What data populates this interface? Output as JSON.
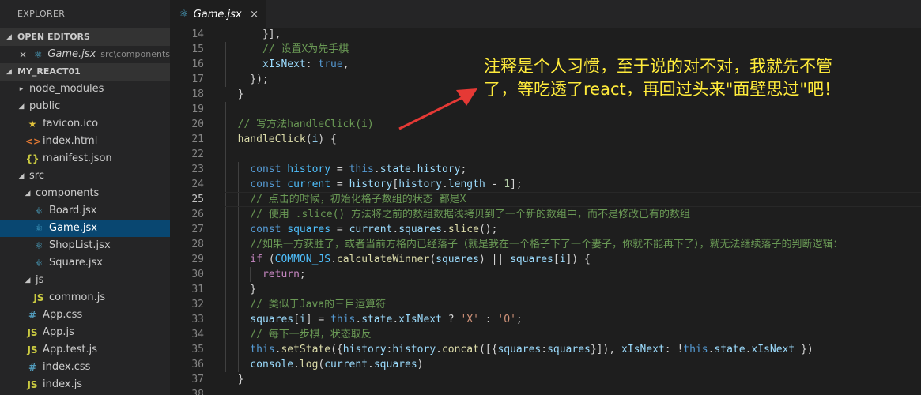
{
  "sidebar": {
    "title": "EXPLORER",
    "open_editors": {
      "header": "OPEN EDITORS",
      "items": [
        {
          "name": "Game.jsx",
          "path": "src\\components",
          "icon": "react-icon"
        }
      ]
    },
    "project": {
      "header": "MY_REACT01",
      "tree": [
        {
          "label": "node_modules",
          "type": "folder",
          "expanded": false,
          "depth": 0
        },
        {
          "label": "public",
          "type": "folder",
          "expanded": true,
          "depth": 0
        },
        {
          "label": "favicon.ico",
          "type": "file",
          "icon": "star-icon",
          "depth": 1
        },
        {
          "label": "index.html",
          "type": "file",
          "icon": "html-icon",
          "depth": 1
        },
        {
          "label": "manifest.json",
          "type": "file",
          "icon": "json-icon",
          "depth": 1
        },
        {
          "label": "src",
          "type": "folder",
          "expanded": true,
          "depth": 0
        },
        {
          "label": "components",
          "type": "folder",
          "expanded": true,
          "depth": 1
        },
        {
          "label": "Board.jsx",
          "type": "file",
          "icon": "react-icon",
          "depth": 2
        },
        {
          "label": "Game.jsx",
          "type": "file",
          "icon": "react-icon",
          "depth": 2,
          "active": true
        },
        {
          "label": "ShopList.jsx",
          "type": "file",
          "icon": "react-icon",
          "depth": 2
        },
        {
          "label": "Square.jsx",
          "type": "file",
          "icon": "react-icon",
          "depth": 2
        },
        {
          "label": "js",
          "type": "folder",
          "expanded": true,
          "depth": 1
        },
        {
          "label": "common.js",
          "type": "file",
          "icon": "js-icon",
          "depth": 2
        },
        {
          "label": "App.css",
          "type": "file",
          "icon": "css-icon",
          "depth": 1
        },
        {
          "label": "App.js",
          "type": "file",
          "icon": "js-icon",
          "depth": 1
        },
        {
          "label": "App.test.js",
          "type": "file",
          "icon": "js-icon",
          "depth": 1
        },
        {
          "label": "index.css",
          "type": "file",
          "icon": "css-icon",
          "depth": 1
        },
        {
          "label": "index.js",
          "type": "file",
          "icon": "js-icon",
          "depth": 1
        }
      ]
    }
  },
  "tab": {
    "label": "Game.jsx",
    "icon": "react-icon",
    "close": "×"
  },
  "editor": {
    "current_line": 25,
    "lines": [
      {
        "n": "14",
        "tokens": [
          [
            "op",
            "      }],"
          ]
        ]
      },
      {
        "n": "15",
        "tokens": [
          [
            "cm",
            "      // 设置X为先手棋"
          ]
        ]
      },
      {
        "n": "16",
        "tokens": [
          [
            "var",
            "      xIsNext"
          ],
          [
            "op",
            ": "
          ],
          [
            "kw",
            "true"
          ],
          [
            "op",
            ","
          ]
        ]
      },
      {
        "n": "17",
        "tokens": [
          [
            "op",
            "    });"
          ]
        ]
      },
      {
        "n": "18",
        "tokens": [
          [
            "op",
            "  }"
          ]
        ]
      },
      {
        "n": "19",
        "tokens": []
      },
      {
        "n": "20",
        "tokens": [
          [
            "cm",
            "  // 写方法handleClick(i)"
          ]
        ]
      },
      {
        "n": "21",
        "tokens": [
          [
            "fn",
            "  handleClick"
          ],
          [
            "op",
            "("
          ],
          [
            "var",
            "i"
          ],
          [
            "op",
            ") {"
          ]
        ]
      },
      {
        "n": "22",
        "tokens": []
      },
      {
        "n": "23",
        "tokens": [
          [
            "kw",
            "    const "
          ],
          [
            "const",
            "history"
          ],
          [
            "op",
            " = "
          ],
          [
            "kw",
            "this"
          ],
          [
            "op",
            "."
          ],
          [
            "var",
            "state"
          ],
          [
            "op",
            "."
          ],
          [
            "var",
            "history"
          ],
          [
            "op",
            ";"
          ]
        ]
      },
      {
        "n": "24",
        "tokens": [
          [
            "kw",
            "    const "
          ],
          [
            "const",
            "current"
          ],
          [
            "op",
            " = "
          ],
          [
            "var",
            "history"
          ],
          [
            "op",
            "["
          ],
          [
            "var",
            "history"
          ],
          [
            "op",
            "."
          ],
          [
            "var",
            "length"
          ],
          [
            "op",
            " - "
          ],
          [
            "num",
            "1"
          ],
          [
            "op",
            "];"
          ]
        ]
      },
      {
        "n": "25",
        "tokens": [
          [
            "cm",
            "    // 点击的时候，初始化格子数组的状态 都是X"
          ]
        ]
      },
      {
        "n": "26",
        "tokens": [
          [
            "cm",
            "    // 使用 .slice() 方法将之前的数组数据浅拷贝到了一个新的数组中，而不是修改已有的数组"
          ]
        ]
      },
      {
        "n": "27",
        "tokens": [
          [
            "kw",
            "    const "
          ],
          [
            "const",
            "squares"
          ],
          [
            "op",
            " = "
          ],
          [
            "var",
            "current"
          ],
          [
            "op",
            "."
          ],
          [
            "var",
            "squares"
          ],
          [
            "op",
            "."
          ],
          [
            "fn",
            "slice"
          ],
          [
            "op",
            "();"
          ]
        ]
      },
      {
        "n": "28",
        "tokens": [
          [
            "cm",
            "    //如果一方获胜了，或者当前方格内已经落子（就是我在一个格子下了一个妻子，你就不能再下了），就无法继续落子的判断逻辑："
          ]
        ]
      },
      {
        "n": "29",
        "tokens": [
          [
            "ctl",
            "    if "
          ],
          [
            "op",
            "("
          ],
          [
            "const",
            "COMMON_JS"
          ],
          [
            "op",
            "."
          ],
          [
            "fn",
            "calculateWinner"
          ],
          [
            "op",
            "("
          ],
          [
            "var",
            "squares"
          ],
          [
            "op",
            ") || "
          ],
          [
            "var",
            "squares"
          ],
          [
            "op",
            "["
          ],
          [
            "var",
            "i"
          ],
          [
            "op",
            "]) {"
          ]
        ]
      },
      {
        "n": "30",
        "tokens": [
          [
            "ctl",
            "      return"
          ],
          [
            "op",
            ";"
          ]
        ]
      },
      {
        "n": "31",
        "tokens": [
          [
            "op",
            "    }"
          ]
        ]
      },
      {
        "n": "32",
        "tokens": [
          [
            "cm",
            "    // 类似于Java的三目运算符"
          ]
        ]
      },
      {
        "n": "33",
        "tokens": [
          [
            "var",
            "    squares"
          ],
          [
            "op",
            "["
          ],
          [
            "var",
            "i"
          ],
          [
            "op",
            "] = "
          ],
          [
            "kw",
            "this"
          ],
          [
            "op",
            "."
          ],
          [
            "var",
            "state"
          ],
          [
            "op",
            "."
          ],
          [
            "var",
            "xIsNext"
          ],
          [
            "op",
            " ? "
          ],
          [
            "str",
            "'X'"
          ],
          [
            "op",
            " : "
          ],
          [
            "str",
            "'O'"
          ],
          [
            "op",
            ";"
          ]
        ]
      },
      {
        "n": "34",
        "tokens": [
          [
            "cm",
            "    // 每下一步棋，状态取反"
          ]
        ]
      },
      {
        "n": "35",
        "tokens": [
          [
            "kw",
            "    this"
          ],
          [
            "op",
            "."
          ],
          [
            "fn",
            "setState"
          ],
          [
            "op",
            "({"
          ],
          [
            "var",
            "history"
          ],
          [
            "op",
            ":"
          ],
          [
            "var",
            "history"
          ],
          [
            "op",
            "."
          ],
          [
            "fn",
            "concat"
          ],
          [
            "op",
            "([{"
          ],
          [
            "var",
            "squares"
          ],
          [
            "op",
            ":"
          ],
          [
            "var",
            "squares"
          ],
          [
            "op",
            "}]), "
          ],
          [
            "var",
            "xIsNext"
          ],
          [
            "op",
            ": !"
          ],
          [
            "kw",
            "this"
          ],
          [
            "op",
            "."
          ],
          [
            "var",
            "state"
          ],
          [
            "op",
            "."
          ],
          [
            "var",
            "xIsNext"
          ],
          [
            "op",
            " })"
          ]
        ]
      },
      {
        "n": "36",
        "tokens": [
          [
            "var",
            "    console"
          ],
          [
            "op",
            "."
          ],
          [
            "fn",
            "log"
          ],
          [
            "op",
            "("
          ],
          [
            "var",
            "current"
          ],
          [
            "op",
            "."
          ],
          [
            "var",
            "squares"
          ],
          [
            "op",
            ")"
          ]
        ]
      },
      {
        "n": "37",
        "tokens": [
          [
            "op",
            "  }"
          ]
        ]
      },
      {
        "n": "38",
        "tokens": []
      }
    ]
  },
  "annotation": {
    "line1": "注释是个人习惯，至于说的对不对，我就先不管",
    "line2": "了，等吃透了react，再回过头来\"面壁思过\"吧！",
    "color": "#ffeb3b",
    "arrow_color": "#e53935"
  }
}
